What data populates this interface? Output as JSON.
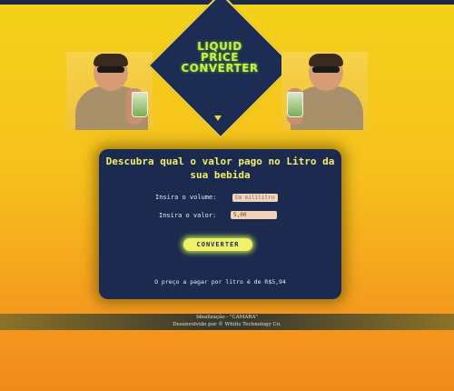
{
  "logo": {
    "line1": "LIQUID",
    "line2": "PRICE",
    "line3": "CONVERTER"
  },
  "converter": {
    "title": "Descubra qual o valor pago no Litro da sua bebida",
    "volume_label": "Insira o volume:",
    "volume_placeholder": "Em mililitros",
    "value_label": "Insira o valor:",
    "value_input": "5,00",
    "button_label": "CONVERTER",
    "result_text": "O preço a pagar por litro é de R$5,94"
  },
  "footer": {
    "line1": "Idealização - \"CAMARA\"",
    "line2": "Desenvolvido por © Whitis Technology Co."
  },
  "colors": {
    "background_top": "#f3d21a",
    "background_bottom": "#f28a1c",
    "panel": "#1b2a4e",
    "accent": "#c8f24a"
  }
}
